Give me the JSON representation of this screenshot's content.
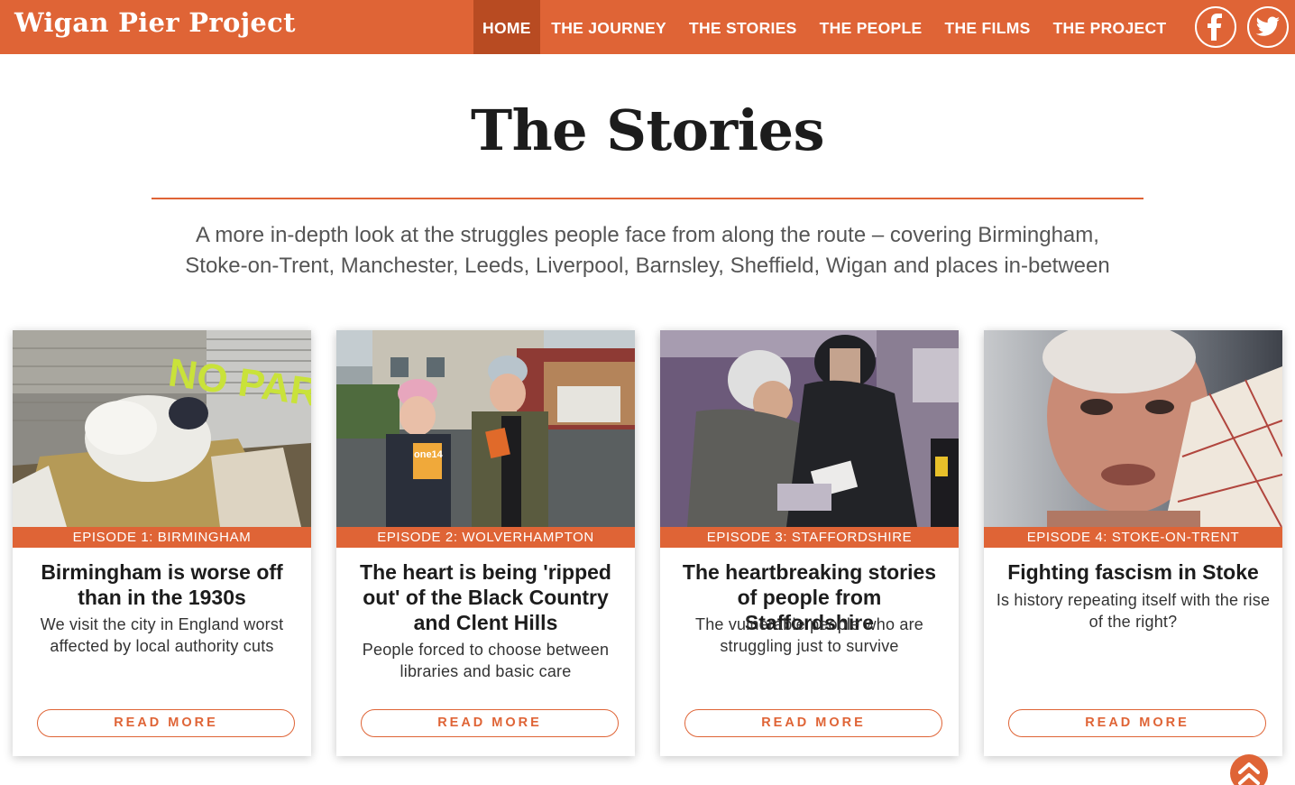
{
  "header": {
    "site_title": "Wigan Pier Project",
    "nav": [
      {
        "label": "HOME",
        "active": true
      },
      {
        "label": "THE JOURNEY"
      },
      {
        "label": "THE STORIES"
      },
      {
        "label": "THE PEOPLE"
      },
      {
        "label": "THE FILMS"
      },
      {
        "label": "THE PROJECT"
      }
    ],
    "social": [
      "facebook-icon",
      "twitter-icon"
    ]
  },
  "main": {
    "title": "The Stories",
    "intro_line1": "A more in-depth look at the struggles people face from along the route – covering Birmingham,",
    "intro_line2": "Stoke-on-Trent, Manchester, Leeds, Liverpool, Barnsley, Sheffield, Wigan and places in-between"
  },
  "cards": [
    {
      "episode": "EPISODE 1: BIRMINGHAM",
      "title": "Birmingham is worse off than in the 1930s",
      "desc": "We visit the city in England worst affected by local authority cuts",
      "button": "READ MORE",
      "photo_text": "NO PAR"
    },
    {
      "episode": "EPISODE 2: WOLVERHAMPTON",
      "title": "The heart is being 'ripped out' of the Black Country and Clent Hills",
      "desc": "People forced to choose between libraries and basic care",
      "button": "READ MORE",
      "photo_text": "one14"
    },
    {
      "episode": "EPISODE 3: STAFFORDSHIRE",
      "title": "The heartbreaking stories of people from Staffordshire",
      "desc": "The vulnerable people who are struggling just to survive",
      "button": "READ MORE"
    },
    {
      "episode": "EPISODE 4: STOKE-ON-TRENT",
      "title": "Fighting fascism in Stoke",
      "desc": "Is history repeating itself with the rise of the right?",
      "button": "READ MORE"
    }
  ],
  "colors": {
    "accent": "#df6436",
    "accent_dark": "#b84b22"
  },
  "icons": {
    "back_to_top": "double-chevron-up-icon"
  }
}
